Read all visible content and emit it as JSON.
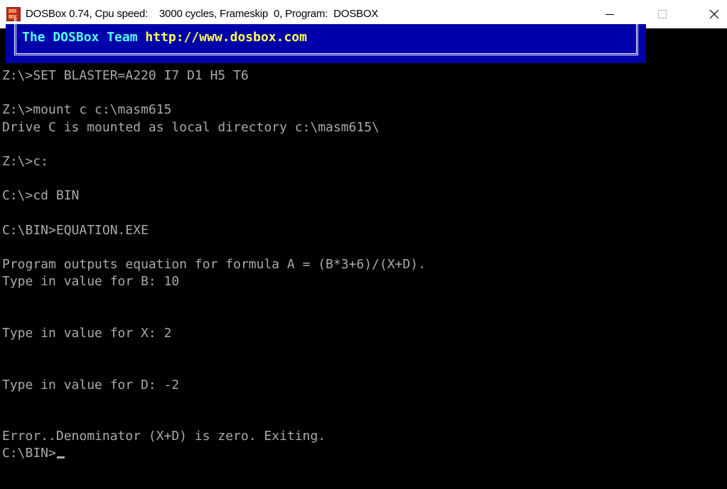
{
  "window": {
    "title": "DOSBox 0.74, Cpu speed:    3000 cycles, Frameskip  0, Program:  DOSBOX",
    "icon_top": "DOS",
    "icon_bottom": "BOX",
    "controls": {
      "minimize": "minimize-icon",
      "maximize": "maximize-icon",
      "close": "close-icon"
    }
  },
  "banner": {
    "team": "The DOSBox Team",
    "url": "http://www.dosbox.com"
  },
  "console": {
    "lines": [
      "Z:\\>SET BLASTER=A220 I7 D1 H5 T6",
      "",
      "Z:\\>mount c c:\\masm615",
      "Drive C is mounted as local directory c:\\masm615\\",
      "",
      "Z:\\>c:",
      "",
      "C:\\>cd BIN",
      "",
      "C:\\BIN>EQUATION.EXE",
      "",
      "Program outputs equation for formula A = (B*3+6)/(X+D).",
      "Type in value for B: 10",
      "",
      "",
      "Type in value for X: 2",
      "",
      "",
      "Type in value for D: -2",
      "",
      "",
      "Error..Denominator (X+D) is zero. Exiting.",
      "C:\\BIN>"
    ]
  },
  "colors": {
    "background": "#000000",
    "text": "#aaaaaa",
    "banner_bg": "#0000aa",
    "banner_team": "#55ffff",
    "banner_url": "#ffff55"
  }
}
